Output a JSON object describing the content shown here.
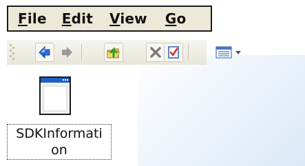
{
  "menubar": {
    "items": [
      {
        "mnemonic": "F",
        "rest": "ile"
      },
      {
        "mnemonic": "E",
        "rest": "dit"
      },
      {
        "mnemonic": "V",
        "rest": "iew"
      },
      {
        "mnemonic": "G",
        "rest": "o"
      }
    ]
  },
  "toolbar": {
    "icons": [
      "back-icon",
      "forward-icon",
      "up-folder-icon",
      "delete-icon",
      "properties-icon",
      "views-icon"
    ]
  },
  "desktop": {
    "file": {
      "name_line1": "SDKInformati",
      "name_line2": "on",
      "icon": "application-window-icon"
    }
  },
  "colors": {
    "menubar_bg": "#ece9d8",
    "back_arrow": "#2b6fd6",
    "delete_x": "#7b7b7b",
    "check_red": "#d42a2a"
  }
}
